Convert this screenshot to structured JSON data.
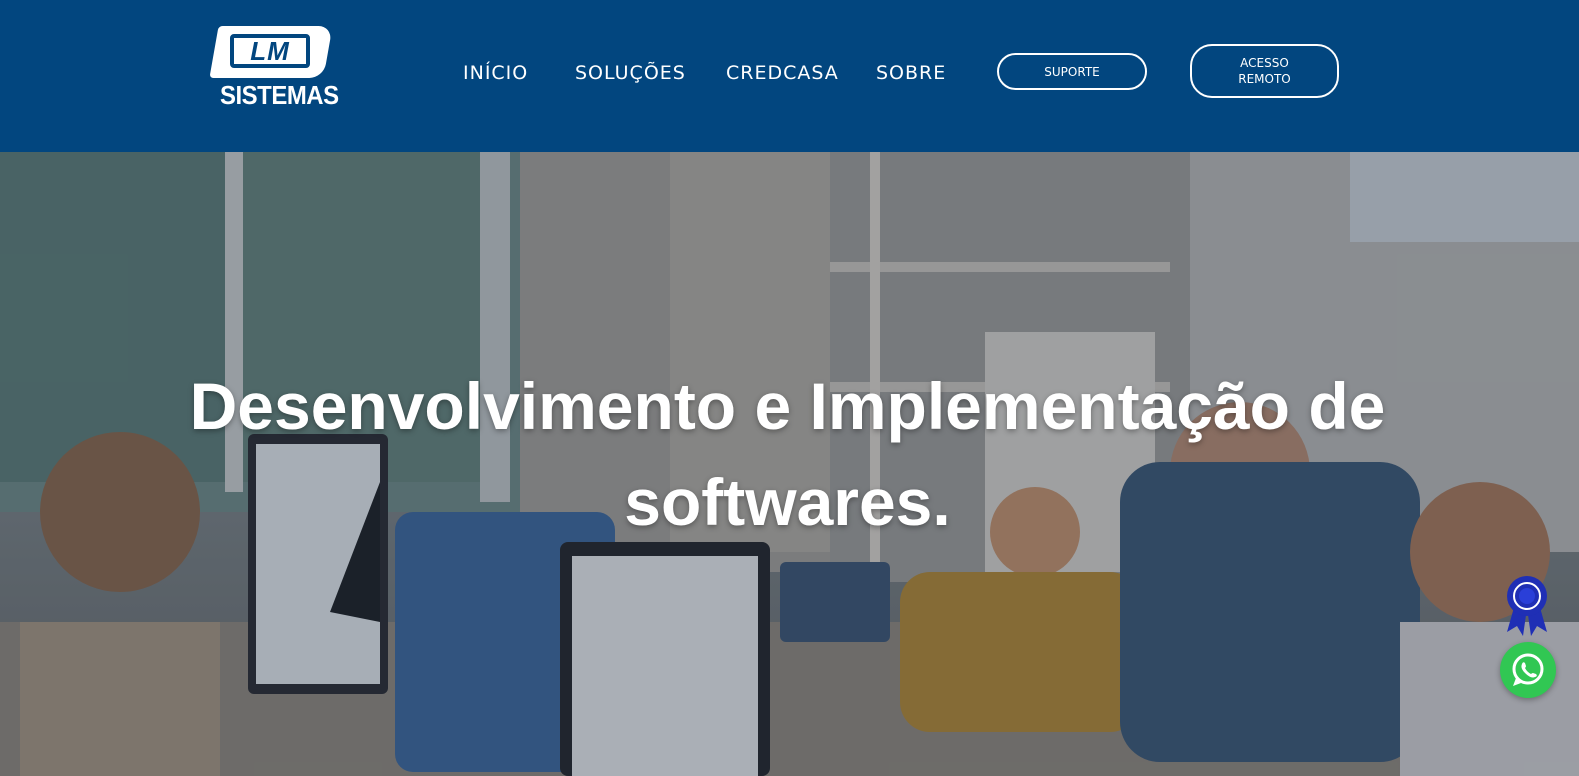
{
  "header": {
    "logo": {
      "mark": "LM",
      "name": "SISTEMAS"
    },
    "nav": [
      {
        "label": "INÍCIO"
      },
      {
        "label": "SOLUÇÕES"
      },
      {
        "label": "CREDCASA"
      },
      {
        "label": "SOBRE"
      }
    ],
    "buttons": {
      "suporte": "SUPORTE",
      "acesso_remoto": "ACESSO REMOTO"
    }
  },
  "hero": {
    "title_line1": "Desenvolvimento e Implementação de",
    "title_line2": "softwares."
  },
  "floating": {
    "badge_icon": "award-ribbon-icon",
    "whatsapp_icon": "whatsapp-icon"
  },
  "colors": {
    "header_bg": "#02467f",
    "whatsapp": "#31c753",
    "badge": "#1f2fb5"
  }
}
